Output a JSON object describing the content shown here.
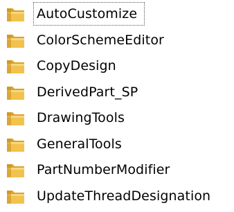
{
  "explorer": {
    "folder_icon": "folder-icon",
    "colors": {
      "folder_front": "#f2c24f",
      "folder_back": "#d9a42a",
      "folder_tab": "#c98f1f",
      "text": "#000000"
    },
    "items": [
      {
        "label": "AutoCustomize",
        "focused": true
      },
      {
        "label": "ColorSchemeEditor",
        "focused": false
      },
      {
        "label": "CopyDesign",
        "focused": false
      },
      {
        "label": "DerivedPart_SP",
        "focused": false
      },
      {
        "label": "DrawingTools",
        "focused": false
      },
      {
        "label": "GeneralTools",
        "focused": false
      },
      {
        "label": "PartNumberModifier",
        "focused": false
      },
      {
        "label": "UpdateThreadDesignation",
        "focused": false
      }
    ]
  }
}
